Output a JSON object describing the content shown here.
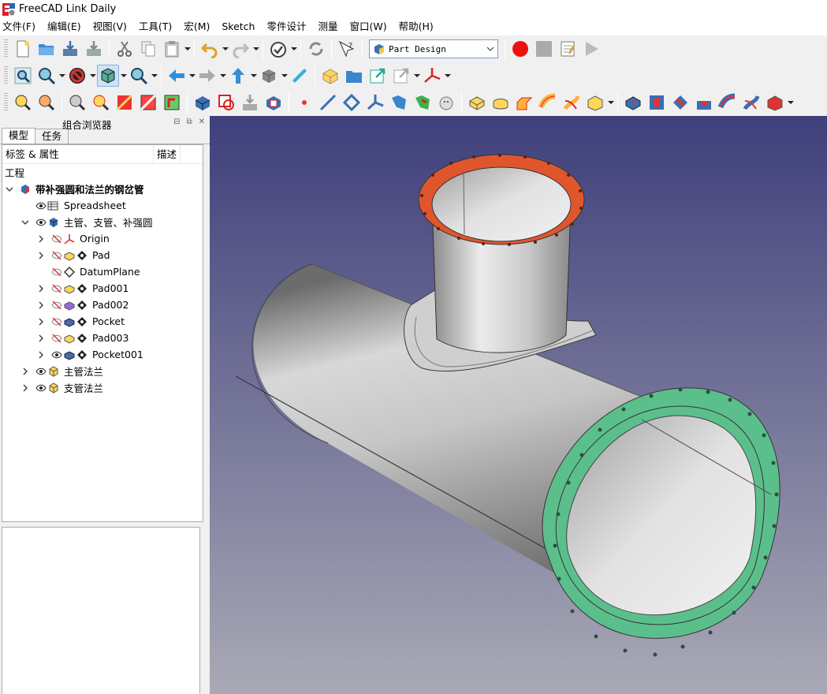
{
  "window": {
    "title": "FreeCAD Link Daily"
  },
  "menubar": [
    "文件(F)",
    "编辑(E)",
    "视图(V)",
    "工具(T)",
    "宏(M)",
    "Sketch",
    "零件设计",
    "测量",
    "窗口(W)",
    "帮助(H)"
  ],
  "toolbar": {
    "workbench": "Part Design"
  },
  "combo": {
    "title": "组合浏览器",
    "tabs": [
      "模型",
      "任务"
    ],
    "columns": [
      "标签 & 属性",
      "描述"
    ],
    "root_label": "工程"
  },
  "tree": [
    {
      "label": "带补强圆和法兰的钢岔管",
      "bold": true,
      "icon": "part-icon"
    },
    {
      "label": "Spreadsheet",
      "icon": "spreadsheet-icon"
    },
    {
      "label": "主管、支管、补强圆",
      "icon": "body-icon"
    },
    {
      "label": "Origin",
      "icon": "origin-icon"
    },
    {
      "label": "Pad",
      "icon": "pad-icon"
    },
    {
      "label": "DatumPlane",
      "icon": "datum-plane-icon"
    },
    {
      "label": "Pad001",
      "icon": "pad-icon"
    },
    {
      "label": "Pad002",
      "icon": "pad-icon"
    },
    {
      "label": "Pocket",
      "icon": "pocket-icon"
    },
    {
      "label": "Pad003",
      "icon": "pad-icon"
    },
    {
      "label": "Pocket001",
      "icon": "pocket-icon"
    },
    {
      "label": "主管法兰",
      "icon": "pad-icon"
    },
    {
      "label": "支管法兰",
      "icon": "pad-icon"
    }
  ],
  "viewport": {
    "background_top": "#3f3f7c",
    "background_bottom": "#a9a9b6",
    "pipe_color": "#bdbdbd",
    "branch_flange_color": "#e0562c",
    "main_flange_color": "#5bbf8c"
  }
}
